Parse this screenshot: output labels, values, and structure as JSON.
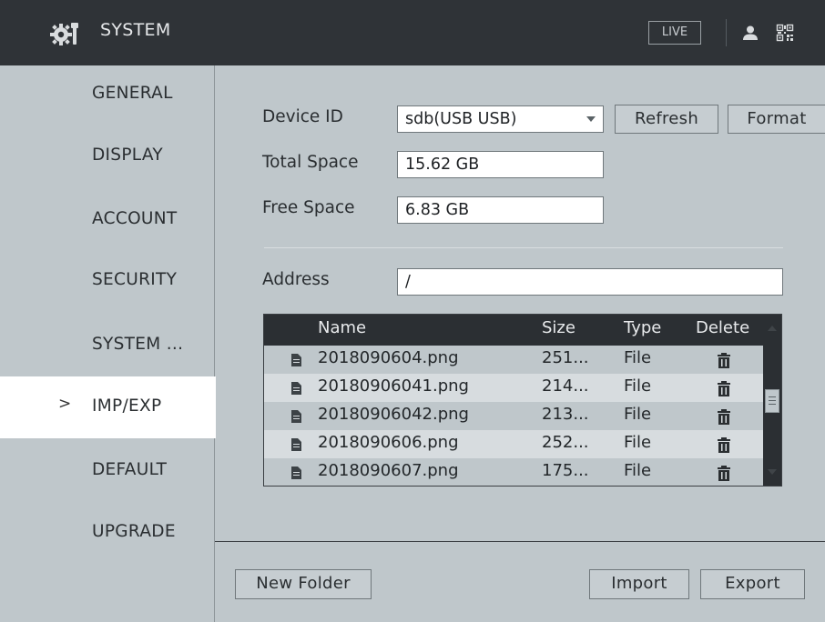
{
  "header": {
    "title": "SYSTEM",
    "live_label": "LIVE",
    "user_icon": "user-icon",
    "qr_icon": "qr-code-icon",
    "settings_icon": "gear-icon"
  },
  "sidebar": {
    "items": [
      {
        "label": "GENERAL"
      },
      {
        "label": "DISPLAY"
      },
      {
        "label": "ACCOUNT"
      },
      {
        "label": "SECURITY"
      },
      {
        "label": "SYSTEM ..."
      },
      {
        "label": "IMP/EXP",
        "active": true,
        "chevron": ">"
      },
      {
        "label": "DEFAULT"
      },
      {
        "label": "UPGRADE"
      }
    ]
  },
  "form": {
    "device_id_label": "Device ID",
    "device_id_value": "sdb(USB USB)",
    "refresh_label": "Refresh",
    "format_label": "Format",
    "total_space_label": "Total Space",
    "total_space_value": "15.62 GB",
    "free_space_label": "Free Space",
    "free_space_value": "6.83 GB",
    "address_label": "Address",
    "address_value": "/"
  },
  "table": {
    "headers": {
      "name": "Name",
      "size": "Size",
      "type": "Type",
      "delete": "Delete"
    },
    "rows": [
      {
        "name": "2018090604.png",
        "size": "251...",
        "type": "File"
      },
      {
        "name": "20180906041.png",
        "size": "214...",
        "type": "File"
      },
      {
        "name": "20180906042.png",
        "size": "213...",
        "type": "File"
      },
      {
        "name": "2018090606.png",
        "size": "252...",
        "type": "File"
      },
      {
        "name": "2018090607.png",
        "size": "175...",
        "type": "File"
      }
    ]
  },
  "footer": {
    "new_folder_label": "New Folder",
    "import_label": "Import",
    "export_label": "Export"
  }
}
